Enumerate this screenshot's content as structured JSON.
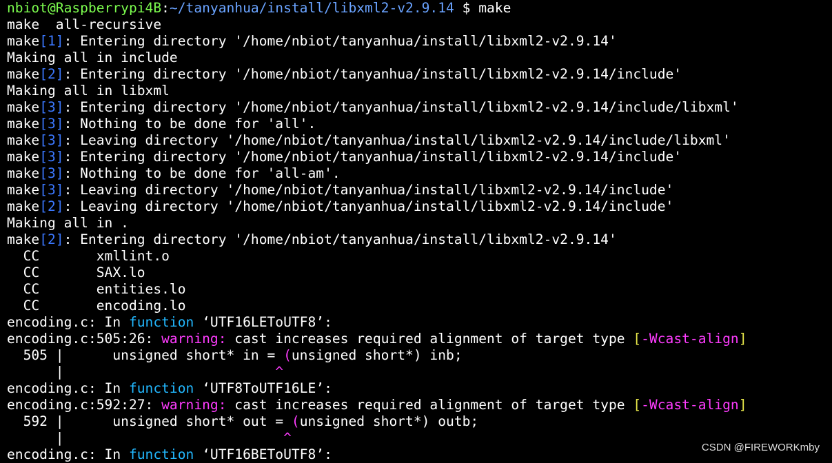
{
  "colors": {
    "background": "#000000",
    "text": "#ffffff",
    "prompt_user": "#7cfc4e",
    "prompt_path": "#6aa3ff",
    "bracket_num": "#3b78ff",
    "function_keyword": "#22b8ff",
    "warning": "#ff3cff",
    "caret": "#ff3cff",
    "flag_bracket": "#e8e84a",
    "flag": "#ff3cff"
  },
  "lines": [
    [
      {
        "t": "nbiot@Raspberrypi4B",
        "c": "prompt_user"
      },
      {
        "t": ":",
        "c": "text"
      },
      {
        "t": "~/tanyanhua/install/libxml2-v2.9.14",
        "c": "prompt_path"
      },
      {
        "t": " $ make",
        "c": "text"
      }
    ],
    [
      {
        "t": "make  all-recursive",
        "c": "text"
      }
    ],
    [
      {
        "t": "make",
        "c": "text"
      },
      {
        "t": "[1]",
        "c": "bracket_num"
      },
      {
        "t": ": Entering directory '/home/nbiot/tanyanhua/install/libxml2-v2.9.14'",
        "c": "text"
      }
    ],
    [
      {
        "t": "Making all in include",
        "c": "text"
      }
    ],
    [
      {
        "t": "make",
        "c": "text"
      },
      {
        "t": "[2]",
        "c": "bracket_num"
      },
      {
        "t": ": Entering directory '/home/nbiot/tanyanhua/install/libxml2-v2.9.14/include'",
        "c": "text"
      }
    ],
    [
      {
        "t": "Making all in libxml",
        "c": "text"
      }
    ],
    [
      {
        "t": "make",
        "c": "text"
      },
      {
        "t": "[3]",
        "c": "bracket_num"
      },
      {
        "t": ": Entering directory '/home/nbiot/tanyanhua/install/libxml2-v2.9.14/include/libxml'",
        "c": "text"
      }
    ],
    [
      {
        "t": "make",
        "c": "text"
      },
      {
        "t": "[3]",
        "c": "bracket_num"
      },
      {
        "t": ": Nothing to be done for 'all'.",
        "c": "text"
      }
    ],
    [
      {
        "t": "make",
        "c": "text"
      },
      {
        "t": "[3]",
        "c": "bracket_num"
      },
      {
        "t": ": Leaving directory '/home/nbiot/tanyanhua/install/libxml2-v2.9.14/include/libxml'",
        "c": "text"
      }
    ],
    [
      {
        "t": "make",
        "c": "text"
      },
      {
        "t": "[3]",
        "c": "bracket_num"
      },
      {
        "t": ": Entering directory '/home/nbiot/tanyanhua/install/libxml2-v2.9.14/include'",
        "c": "text"
      }
    ],
    [
      {
        "t": "make",
        "c": "text"
      },
      {
        "t": "[3]",
        "c": "bracket_num"
      },
      {
        "t": ": Nothing to be done for 'all-am'.",
        "c": "text"
      }
    ],
    [
      {
        "t": "make",
        "c": "text"
      },
      {
        "t": "[3]",
        "c": "bracket_num"
      },
      {
        "t": ": Leaving directory '/home/nbiot/tanyanhua/install/libxml2-v2.9.14/include'",
        "c": "text"
      }
    ],
    [
      {
        "t": "make",
        "c": "text"
      },
      {
        "t": "[2]",
        "c": "bracket_num"
      },
      {
        "t": ": Leaving directory '/home/nbiot/tanyanhua/install/libxml2-v2.9.14/include'",
        "c": "text"
      }
    ],
    [
      {
        "t": "Making all in .",
        "c": "text"
      }
    ],
    [
      {
        "t": "make",
        "c": "text"
      },
      {
        "t": "[2]",
        "c": "bracket_num"
      },
      {
        "t": ": Entering directory '/home/nbiot/tanyanhua/install/libxml2-v2.9.14'",
        "c": "text"
      }
    ],
    [
      {
        "t": "  CC       xmllint.o",
        "c": "text"
      }
    ],
    [
      {
        "t": "  CC       SAX.lo",
        "c": "text"
      }
    ],
    [
      {
        "t": "  CC       entities.lo",
        "c": "text"
      }
    ],
    [
      {
        "t": "  CC       encoding.lo",
        "c": "text"
      }
    ],
    [
      {
        "t": "encoding.c: In ",
        "c": "text"
      },
      {
        "t": "function",
        "c": "function_keyword"
      },
      {
        "t": " ‘UTF16LEToUTF8’:",
        "c": "text"
      }
    ],
    [
      {
        "t": "encoding.c:505:26: ",
        "c": "text"
      },
      {
        "t": "warning:",
        "c": "warning"
      },
      {
        "t": " cast increases required alignment of target type ",
        "c": "text"
      },
      {
        "t": "[",
        "c": "flag_bracket"
      },
      {
        "t": "-Wcast-align",
        "c": "flag"
      },
      {
        "t": "]",
        "c": "flag_bracket"
      }
    ],
    [
      {
        "t": "  505 |      unsigned short* in = ",
        "c": "text"
      },
      {
        "t": "(",
        "c": "caret"
      },
      {
        "t": "unsigned short*) inb;",
        "c": "text"
      }
    ],
    [
      {
        "t": "      |                          ",
        "c": "text"
      },
      {
        "t": "^",
        "c": "caret"
      }
    ],
    [
      {
        "t": "encoding.c: In ",
        "c": "text"
      },
      {
        "t": "function",
        "c": "function_keyword"
      },
      {
        "t": " ‘UTF8ToUTF16LE’:",
        "c": "text"
      }
    ],
    [
      {
        "t": "encoding.c:592:27: ",
        "c": "text"
      },
      {
        "t": "warning:",
        "c": "warning"
      },
      {
        "t": " cast increases required alignment of target type ",
        "c": "text"
      },
      {
        "t": "[",
        "c": "flag_bracket"
      },
      {
        "t": "-Wcast-align",
        "c": "flag"
      },
      {
        "t": "]",
        "c": "flag_bracket"
      }
    ],
    [
      {
        "t": "  592 |      unsigned short* out = ",
        "c": "text"
      },
      {
        "t": "(",
        "c": "caret"
      },
      {
        "t": "unsigned short*) outb;",
        "c": "text"
      }
    ],
    [
      {
        "t": "      |                           ",
        "c": "text"
      },
      {
        "t": "^",
        "c": "caret"
      }
    ],
    [
      {
        "t": "encoding.c: In ",
        "c": "text"
      },
      {
        "t": "function",
        "c": "function_keyword"
      },
      {
        "t": " ‘UTF16BEToUTF8’:",
        "c": "text"
      }
    ]
  ],
  "watermark": "CSDN @FIREWORKmby"
}
